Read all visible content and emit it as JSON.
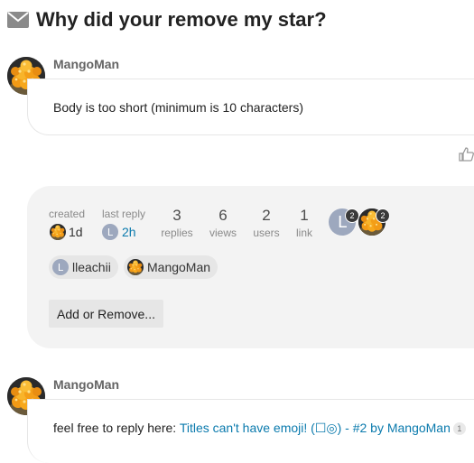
{
  "topic": {
    "title": "Why did your remove my star?",
    "icon": "envelope-icon"
  },
  "post1": {
    "username": "MangoMan",
    "body": "Body is too short (minimum is 10 characters)"
  },
  "topic_map": {
    "created_label": "created",
    "created_value": "1d",
    "last_reply_label": "last reply",
    "last_reply_value": "2h",
    "replies_count": "3",
    "replies_label": "replies",
    "views_count": "6",
    "views_label": "views",
    "users_count": "2",
    "users_label": "users",
    "link_count": "1",
    "link_label": "link",
    "top_posters": [
      {
        "letter": "L",
        "badge": "2"
      },
      {
        "badge": "2"
      }
    ],
    "participants": [
      {
        "letter": "L",
        "name": "lleachii"
      },
      {
        "name": "MangoMan"
      }
    ],
    "add_remove_label": "Add or Remove..."
  },
  "post2": {
    "username": "MangoMan",
    "body_prefix": "feel free to reply here: ",
    "link_text": "Titles can't have emoji! (☐◎)",
    "link_suffix": " - #2 by MangoMan",
    "click_count": "1"
  },
  "colors": {
    "link": "#0a7aad",
    "letter_avatar": "#9da8be",
    "map_background": "#f3f3f3"
  }
}
